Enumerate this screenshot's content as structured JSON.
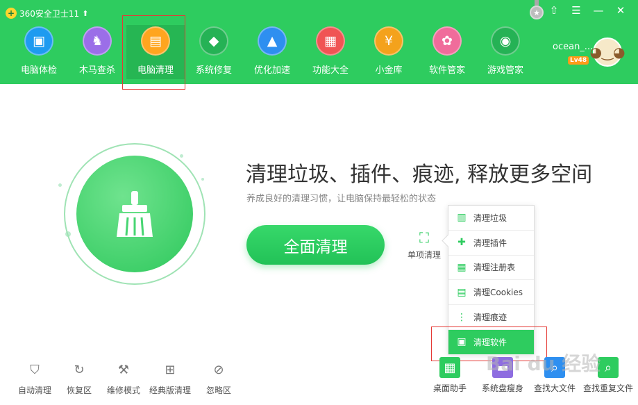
{
  "app": {
    "title": "360安全卫士11"
  },
  "window_controls": [
    {
      "name": "skin-icon",
      "glyph": "⇧"
    },
    {
      "name": "menu-icon",
      "glyph": "☰"
    },
    {
      "name": "minimize-icon",
      "glyph": "—"
    },
    {
      "name": "close-icon",
      "glyph": "✕"
    }
  ],
  "nav": [
    {
      "label": "电脑体检",
      "icon": "monitor-icon",
      "glyph": "▣",
      "color": "#1e9bf0"
    },
    {
      "label": "木马查杀",
      "icon": "horse-icon",
      "glyph": "♞",
      "color": "#9b6ee8"
    },
    {
      "label": "电脑清理",
      "icon": "broom-icon",
      "glyph": "▤",
      "color": "#ffa51f",
      "active": true
    },
    {
      "label": "系统修复",
      "icon": "shield-icon",
      "glyph": "◆",
      "color": "#25b255"
    },
    {
      "label": "优化加速",
      "icon": "rocket-icon",
      "glyph": "▲",
      "color": "#2e8ff0"
    },
    {
      "label": "功能大全",
      "icon": "grid-icon",
      "glyph": "▦",
      "color": "#f05454"
    },
    {
      "label": "小金库",
      "icon": "coin-bag-icon",
      "glyph": "¥",
      "color": "#f4a21c"
    },
    {
      "label": "软件管家",
      "icon": "apps-icon",
      "glyph": "✿",
      "color": "#f06c9b"
    },
    {
      "label": "游戏管家",
      "icon": "gamepad-icon",
      "glyph": "◉",
      "color": "#25b255"
    }
  ],
  "user": {
    "name": "ocean_...",
    "level": "Lv48"
  },
  "main": {
    "headline": "清理垃圾、插件、痕迹, 释放更多空间",
    "subline": "养成良好的清理习惯，让电脑保持最轻松的状态",
    "clean_button": "全面清理",
    "single_clean": "单项清理"
  },
  "dropdown": [
    {
      "label": "清理垃圾",
      "icon": "trash-icon",
      "glyph": "▥"
    },
    {
      "label": "清理插件",
      "icon": "puzzle-icon",
      "glyph": "✚"
    },
    {
      "label": "清理注册表",
      "icon": "registry-icon",
      "glyph": "▦"
    },
    {
      "label": "清理Cookies",
      "icon": "document-icon",
      "glyph": "▤"
    },
    {
      "label": "清理痕迹",
      "icon": "footprint-icon",
      "glyph": "⋮"
    },
    {
      "label": "清理软件",
      "icon": "software-box-icon",
      "glyph": "▣",
      "active": true
    }
  ],
  "tools_left": [
    {
      "label": "自动清理",
      "icon": "auto-shield-icon",
      "glyph": "⛉"
    },
    {
      "label": "恢复区",
      "icon": "restore-icon",
      "glyph": "↻"
    },
    {
      "label": "维修模式",
      "icon": "repair-icon",
      "glyph": "⚒"
    },
    {
      "label": "经典版清理",
      "icon": "classic-clean-icon",
      "glyph": "⊞"
    },
    {
      "label": "忽略区",
      "icon": "ignore-icon",
      "glyph": "⊘"
    }
  ],
  "tools_right": [
    {
      "label": "桌面助手",
      "icon": "desktop-helper-icon",
      "glyph": "▦",
      "color": "#2ecc5f"
    },
    {
      "label": "系统盘瘦身",
      "icon": "disk-slim-icon",
      "glyph": "▬",
      "color": "#8e6de0"
    },
    {
      "label": "查找大文件",
      "icon": "find-large-file-icon",
      "glyph": "⌕",
      "color": "#2e8ff0"
    },
    {
      "label": "查找重复文件",
      "icon": "find-duplicate-icon",
      "glyph": "⌕",
      "color": "#2ecc5f"
    }
  ]
}
